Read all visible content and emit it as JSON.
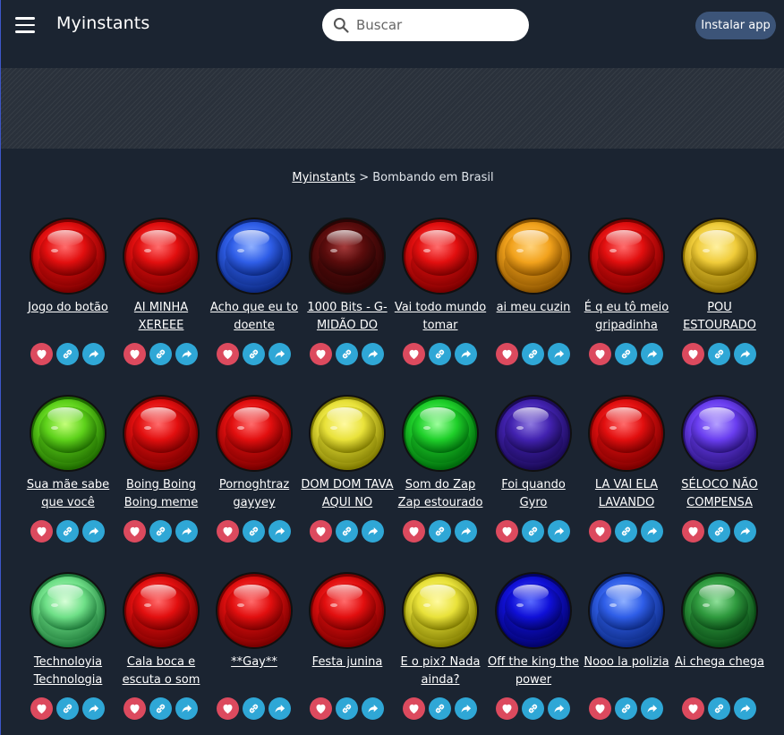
{
  "header": {
    "brand": "Myinstants",
    "search_placeholder": "Buscar",
    "install_label": "Instalar app"
  },
  "breadcrumb": {
    "home": "Myinstants",
    "separator": ">",
    "current": "Bombando em Brasil"
  },
  "colors": {
    "background": "#1b2431",
    "favorite": "#dc4a5e",
    "action": "#2fa7d6",
    "install_button": "#3c5478"
  },
  "sounds": [
    {
      "title": "Jogo do botão",
      "color": "red"
    },
    {
      "title": "AI MINHA XEREEE",
      "color": "red"
    },
    {
      "title": "Acho que eu to doente",
      "color": "blue"
    },
    {
      "title": "1000 Bits - G-MIDÃO DO",
      "color": "maroon"
    },
    {
      "title": "Vai todo mundo tomar",
      "color": "red"
    },
    {
      "title": "ai meu cuzin",
      "color": "orange"
    },
    {
      "title": "É q eu tô meio gripadinha",
      "color": "red"
    },
    {
      "title": "POU ESTOURADO",
      "color": "gold"
    },
    {
      "title": "Sua mãe sabe que você",
      "color": "lime"
    },
    {
      "title": "Boing Boing Boing meme",
      "color": "red"
    },
    {
      "title": "Pornoghtraz gayyey",
      "color": "red"
    },
    {
      "title": "DOM DOM TAVA AQUI NO",
      "color": "yellow"
    },
    {
      "title": "Som do Zap Zap estourado",
      "color": "green"
    },
    {
      "title": "Foi quando Gyro",
      "color": "indigo"
    },
    {
      "title": "LA VAI ELA LAVANDO",
      "color": "red"
    },
    {
      "title": "SÉLOCO NÃO COMPENSA",
      "color": "violet"
    },
    {
      "title": "Technoloyia Technologia",
      "color": "lightgreen"
    },
    {
      "title": "Cala boca e escuta o som",
      "color": "red"
    },
    {
      "title": "**Gay**",
      "color": "red"
    },
    {
      "title": "Festa junina",
      "color": "red"
    },
    {
      "title": "E o pix? Nada ainda?",
      "color": "yellow"
    },
    {
      "title": "Off the king the power",
      "color": "navy"
    },
    {
      "title": "Nooo la polizia",
      "color": "blue"
    },
    {
      "title": "Ai chega chega",
      "color": "darkgreen"
    }
  ]
}
